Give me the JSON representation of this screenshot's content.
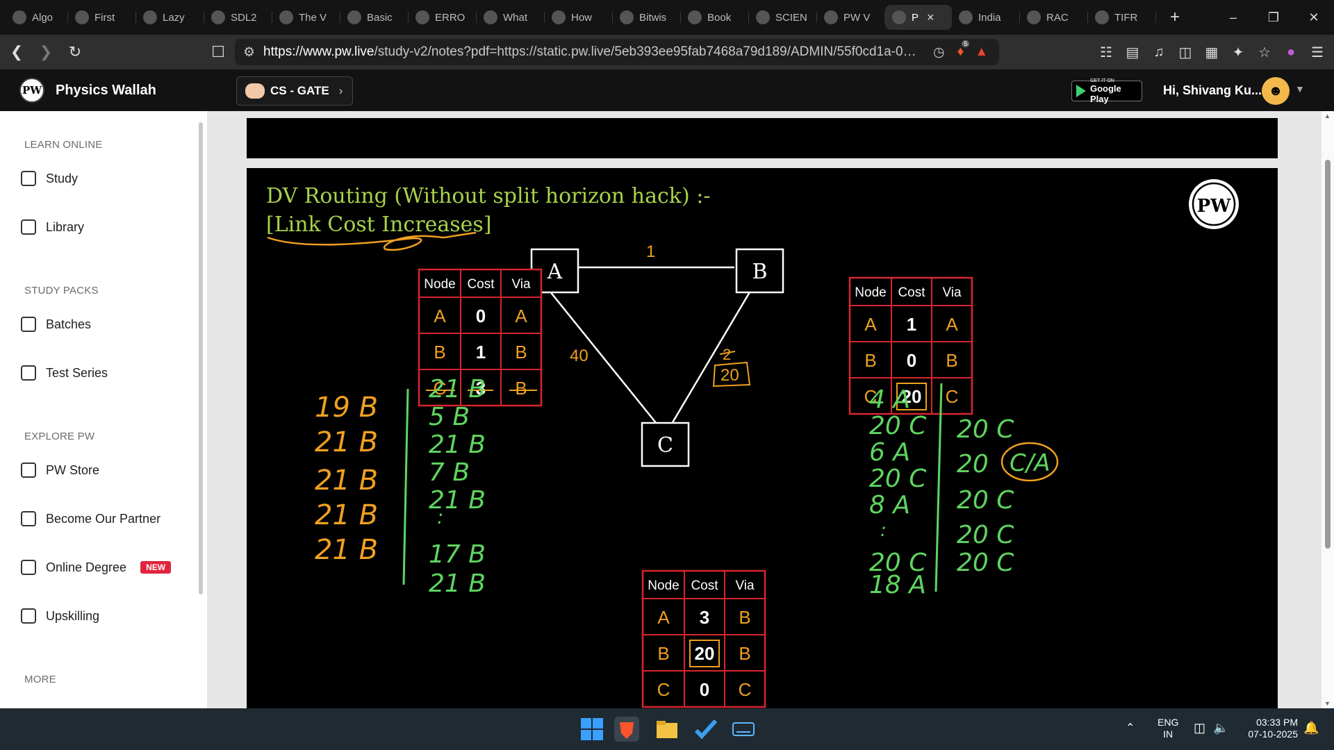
{
  "browser": {
    "tabs": [
      {
        "label": "Algo",
        "active": false
      },
      {
        "label": "First",
        "active": false
      },
      {
        "label": "Lazy",
        "active": false
      },
      {
        "label": "SDL2",
        "active": false
      },
      {
        "label": "The V",
        "active": false
      },
      {
        "label": "Basic",
        "active": false
      },
      {
        "label": "ERRO",
        "active": false
      },
      {
        "label": "What",
        "active": false
      },
      {
        "label": "How",
        "active": false
      },
      {
        "label": "Bitwis",
        "active": false
      },
      {
        "label": "Book",
        "active": false
      },
      {
        "label": "SCIEN",
        "active": false
      },
      {
        "label": "PW V",
        "active": false
      },
      {
        "label": "P",
        "active": true
      },
      {
        "label": "India",
        "active": false
      },
      {
        "label": "RAC",
        "active": false
      },
      {
        "label": "TIFR",
        "active": false
      }
    ],
    "url_host": "https://www.pw.live",
    "url_rest": "/study-v2/notes?pdf=https://static.pw.live/5eb393ee95fab7468a79d189/ADMIN/55f0cd1a-0a21-...",
    "brave_badge": "5"
  },
  "header": {
    "brand": "Physics Wallah",
    "course": "CS - GATE",
    "gplay_top": "GET IT ON",
    "gplay_bottom": "Google Play",
    "greeting": "Hi, Shivang Ku..."
  },
  "sidebar": {
    "sections": [
      {
        "title": "LEARN ONLINE",
        "items": [
          {
            "label": "Study",
            "icon": "edit-icon"
          },
          {
            "label": "Library",
            "icon": "book-icon"
          }
        ]
      },
      {
        "title": "STUDY PACKS",
        "items": [
          {
            "label": "Batches",
            "icon": "monitor-icon"
          },
          {
            "label": "Test Series",
            "icon": "clipboard-icon"
          }
        ]
      },
      {
        "title": "EXPLORE PW",
        "items": [
          {
            "label": "PW Store",
            "icon": "cart-icon"
          },
          {
            "label": "Become Our Partner",
            "icon": "partner-icon"
          },
          {
            "label": "Online Degree",
            "icon": "degree-icon",
            "badge": "NEW"
          },
          {
            "label": "Upskilling",
            "icon": "rocket-icon"
          }
        ]
      },
      {
        "title": "MORE",
        "items": []
      }
    ]
  },
  "slide": {
    "title_line1": "DV Routing (Without split horizon hack)  :-",
    "title_line2": "[Link Cost Increases]",
    "logo": "PW",
    "graph": {
      "nodes": [
        "A",
        "B",
        "C"
      ],
      "edge_ab": "1",
      "edge_ac": "40",
      "edge_bc_old": "2",
      "edge_bc_new": "20"
    },
    "table_headers": [
      "Node",
      "Cost",
      "Via"
    ],
    "table_a": [
      [
        "A",
        "0",
        "A"
      ],
      [
        "B",
        "1",
        "B"
      ],
      [
        "C",
        "3",
        "B"
      ]
    ],
    "table_b": [
      [
        "A",
        "1",
        "A"
      ],
      [
        "B",
        "0",
        "B"
      ],
      [
        "C",
        "20",
        "C"
      ]
    ],
    "table_c": [
      [
        "A",
        "3",
        "B"
      ],
      [
        "B",
        "20",
        "B"
      ],
      [
        "C",
        "0",
        "C"
      ]
    ],
    "notes_left_col1": [
      "19 B",
      "21 B",
      "21 B",
      "21 B",
      "21 B"
    ],
    "notes_left_col2": [
      "21  B",
      "5  B",
      "21  B",
      "7  B",
      "21  B",
      ":",
      "17  B",
      "21  B"
    ],
    "notes_right_col1": [
      "4  A",
      "20  C",
      "6  A",
      "20  C",
      "8  A",
      ":",
      "20  C",
      "18  A"
    ],
    "notes_right_col2": [
      "20 C",
      "20",
      "C/A",
      "20  C",
      "20  C",
      "20  C"
    ]
  },
  "taskbar": {
    "lang_top": "ENG",
    "lang_bottom": "IN",
    "time": "03:33 PM",
    "date": "07-10-2025"
  },
  "colors": {
    "accent_orange": "#f0a020",
    "table_red": "#d8262e",
    "title_green": "#a8d24a",
    "ink_green": "#5fd55f",
    "badge_red": "#e0243e"
  }
}
